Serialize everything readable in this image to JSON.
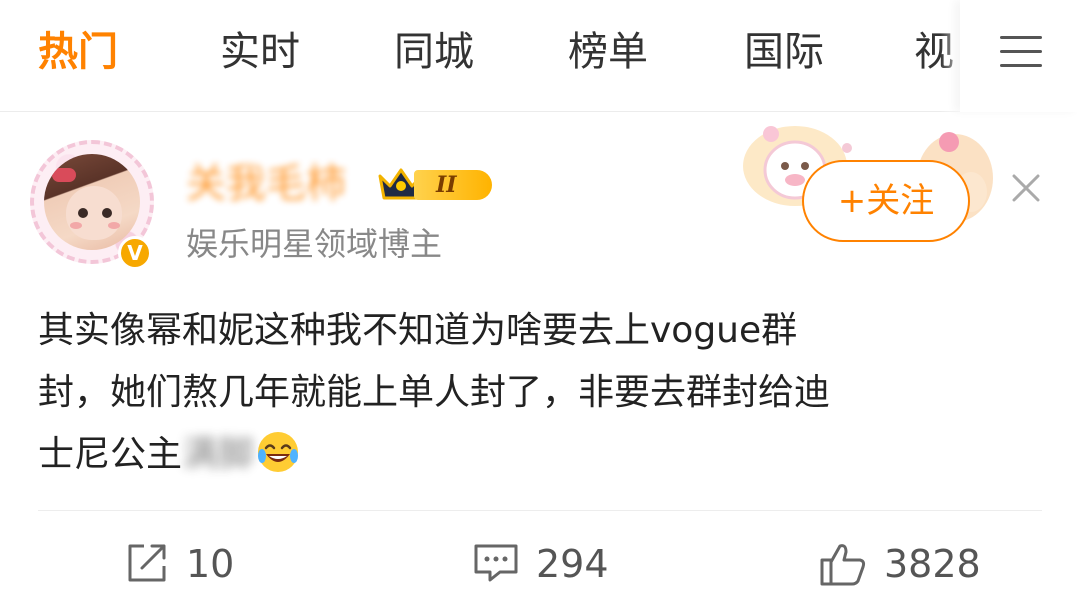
{
  "tabs": [
    {
      "label": "热门",
      "active": true
    },
    {
      "label": "实时",
      "active": false
    },
    {
      "label": "同城",
      "active": false
    },
    {
      "label": "榜单",
      "active": false
    },
    {
      "label": "国际",
      "active": false
    },
    {
      "label": "视",
      "active": false
    }
  ],
  "more_icon": "hamburger-menu-icon",
  "post": {
    "username": "关我毛柿",
    "verified_icon": "v-badge-icon",
    "level_badge": "II",
    "user_description": "娱乐明星领域博主",
    "follow_label": "+关注",
    "close_icon": "close-icon",
    "text_lines": {
      "line1": "其实像幂和妮这种我不知道为啥要去上vogue群",
      "line2": "封，她们熬几年就能上单人封了，非要去群封给迪",
      "line3_visible": "士尼公主",
      "line3_blurred": "满脚"
    },
    "emoji": "laughing-tears-emoji"
  },
  "actions": {
    "repost": {
      "icon": "share-icon",
      "count": "10"
    },
    "comment": {
      "icon": "comment-icon",
      "count": "294"
    },
    "like": {
      "icon": "thumbs-up-icon",
      "count": "3828"
    }
  },
  "colors": {
    "accent": "#ff8200",
    "text": "#222222",
    "secondary": "#888888"
  }
}
